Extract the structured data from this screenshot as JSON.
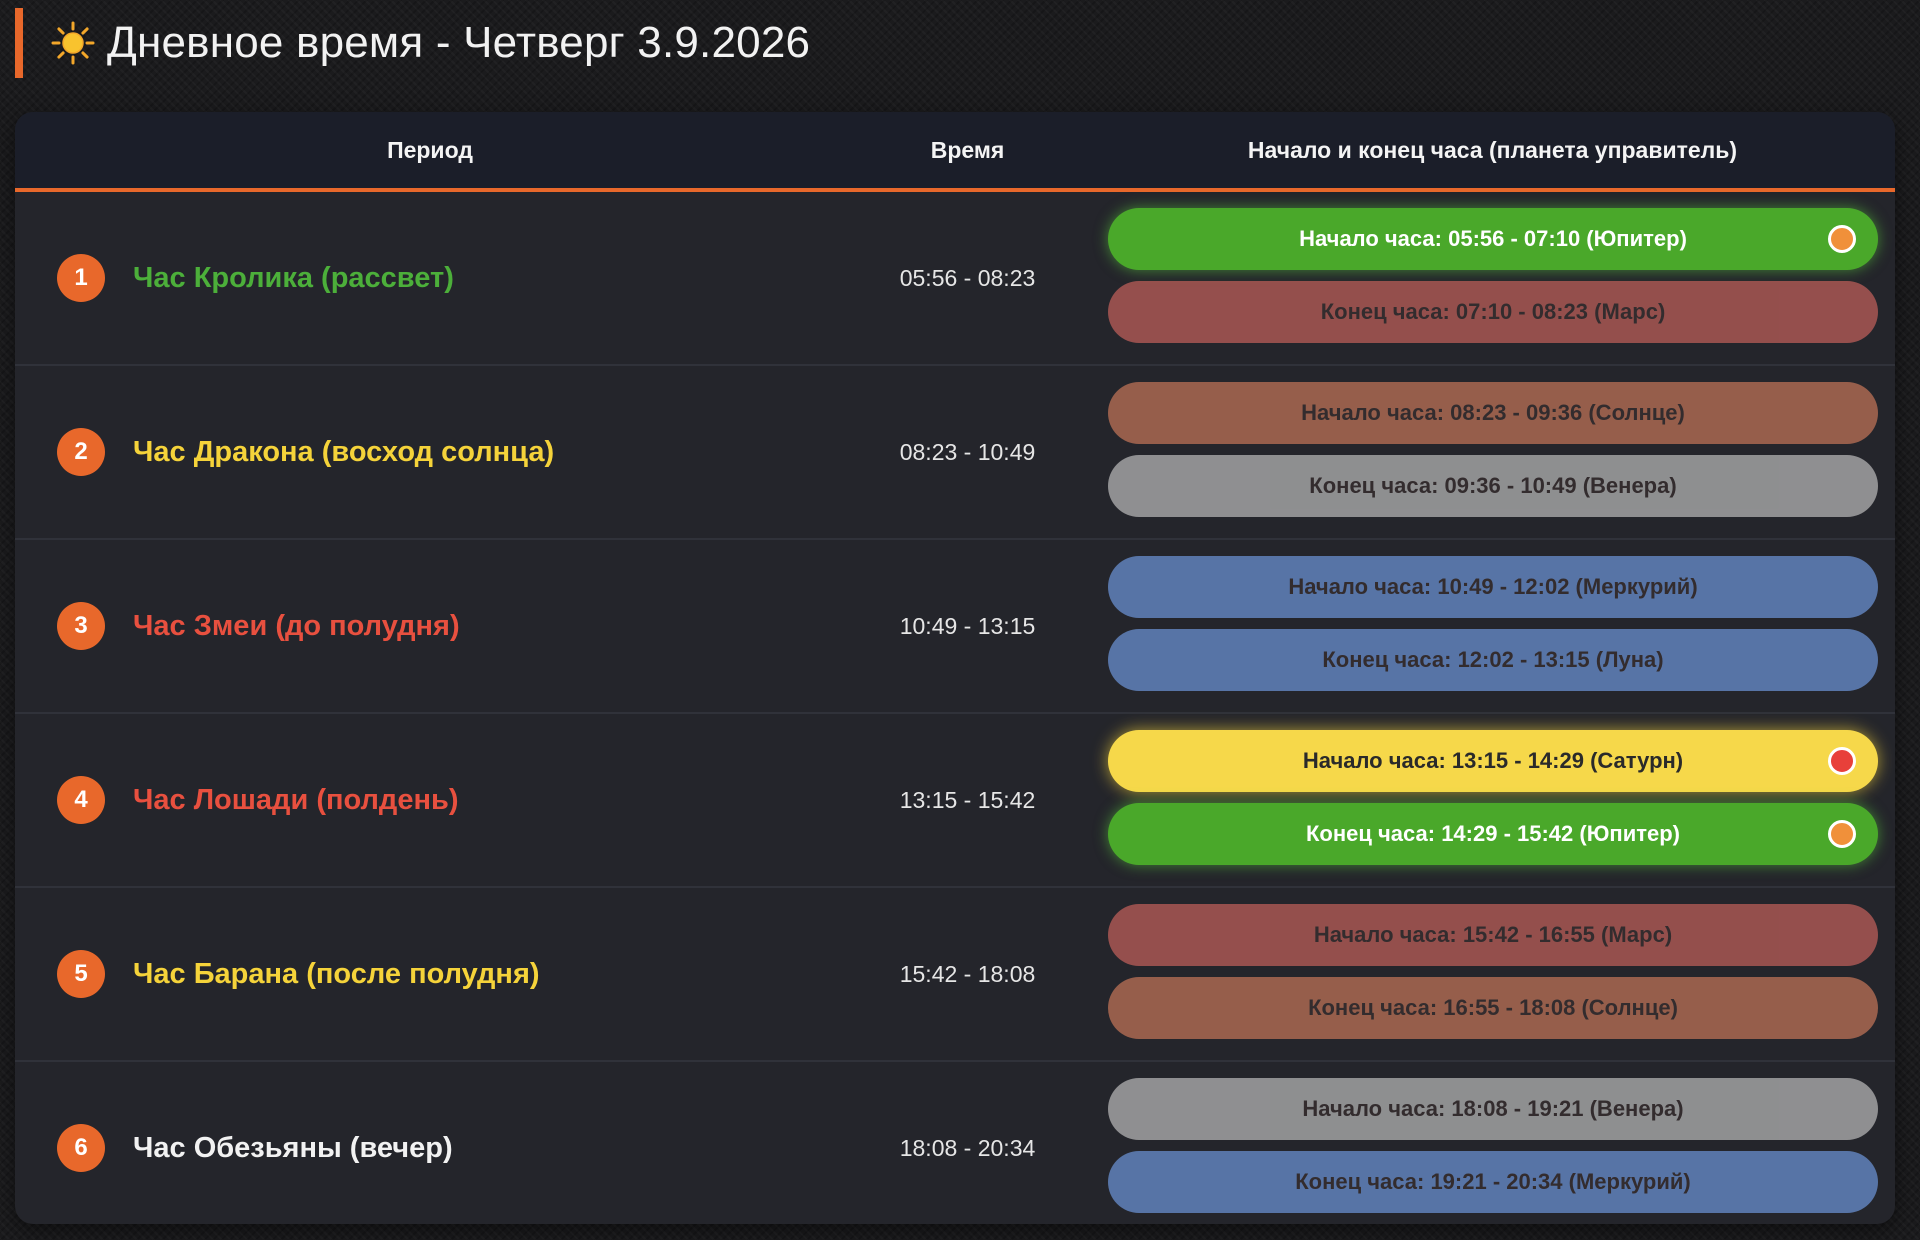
{
  "header": {
    "icon": "sun-icon",
    "title": "Дневное время - Четверг 3.9.2026"
  },
  "table": {
    "columns": {
      "period": "Период",
      "time": "Время",
      "hours": "Начало и конец часа (планета управитель)"
    },
    "rows": [
      {
        "number": "1",
        "name": "Час Кролика (рассвет)",
        "name_color": "#4caf3a",
        "time": "05:56 - 08:23",
        "start": {
          "label": "Начало часа: 05:56 - 07:10 (Юпитер)",
          "color": "#4aa82a",
          "active": true,
          "indicator": "#f0903a"
        },
        "end": {
          "label": "Конец часа: 07:10 - 08:23 (Марс)",
          "color": "#c0605a",
          "active": false
        }
      },
      {
        "number": "2",
        "name": "Час Дракона (восход солнца)",
        "name_color": "#f5d33a",
        "time": "08:23 - 10:49",
        "start": {
          "label": "Начало часа: 08:23 - 09:36 (Солнце)",
          "color": "#c27458",
          "active": false
        },
        "end": {
          "label": "Конец часа: 09:36 - 10:49 (Венера)",
          "color": "#b8b8b8",
          "active": false
        }
      },
      {
        "number": "3",
        "name": "Час Змеи (до полудня)",
        "name_color": "#e8503f",
        "time": "10:49 - 13:15",
        "start": {
          "label": "Начало часа: 10:49 - 12:02 (Меркурий)",
          "color": "#6b93d6",
          "active": false
        },
        "end": {
          "label": "Конец часа: 12:02 - 13:15 (Луна)",
          "color": "#6b93d6",
          "active": false
        }
      },
      {
        "number": "4",
        "name": "Час Лошади (полдень)",
        "name_color": "#e8503f",
        "time": "13:15 - 15:42",
        "start": {
          "label": "Начало часа: 13:15 - 14:29 (Сатурн)",
          "color": "#f6d84a",
          "active": true,
          "indicator": "#e8403a",
          "text_color": "#2a2a2a"
        },
        "end": {
          "label": "Конец часа: 14:29 - 15:42 (Юпитер)",
          "color": "#4aa82a",
          "active": true,
          "indicator": "#f0903a"
        }
      },
      {
        "number": "5",
        "name": "Час Барана (после полудня)",
        "name_color": "#f5d33a",
        "time": "15:42 - 18:08",
        "start": {
          "label": "Начало часа: 15:42 - 16:55 (Марс)",
          "color": "#c0605a",
          "active": false
        },
        "end": {
          "label": "Конец часа: 16:55 - 18:08 (Солнце)",
          "color": "#c27458",
          "active": false
        }
      },
      {
        "number": "6",
        "name": "Час Обезьяны (вечер)",
        "name_color": "#f2f2f2",
        "time": "18:08 - 20:34",
        "start": {
          "label": "Начало часа: 18:08 - 19:21 (Венера)",
          "color": "#b8b8b8",
          "active": false
        },
        "end": {
          "label": "Конец часа: 19:21 - 20:34 (Меркурий)",
          "color": "#6b93d6",
          "active": false
        }
      }
    ]
  }
}
